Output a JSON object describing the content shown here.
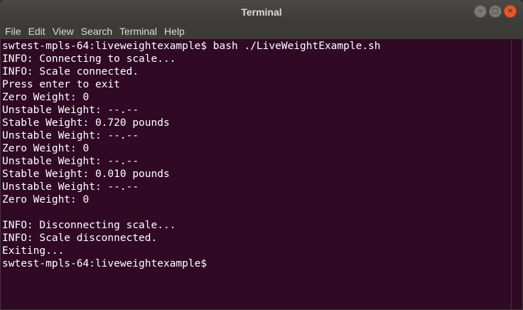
{
  "window": {
    "title": "Terminal"
  },
  "menubar": {
    "items": [
      "File",
      "Edit",
      "View",
      "Search",
      "Terminal",
      "Help"
    ]
  },
  "terminal": {
    "lines": [
      "swtest-mpls-64:liveweightexample$ bash ./LiveWeightExample.sh",
      "INFO: Connecting to scale...",
      "INFO: Scale connected.",
      "Press enter to exit",
      "Zero Weight: 0",
      "Unstable Weight: --.--",
      "Stable Weight: 0.720 pounds",
      "Unstable Weight: --.--",
      "Zero Weight: 0",
      "Unstable Weight: --.--",
      "Stable Weight: 0.010 pounds",
      "Unstable Weight: --.--",
      "Zero Weight: 0",
      "",
      "INFO: Disconnecting scale...",
      "INFO: Scale disconnected.",
      "Exiting...",
      "swtest-mpls-64:liveweightexample$"
    ]
  },
  "colors": {
    "terminal_bg": "#300a24",
    "chrome": "#3c3b37",
    "text": "#ffffff",
    "close_button": "#e9572c"
  }
}
